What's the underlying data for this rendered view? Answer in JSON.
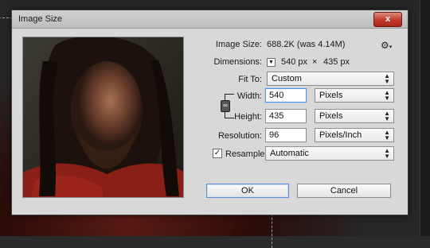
{
  "dialog": {
    "title": "Image Size",
    "close_label": "x"
  },
  "info": {
    "image_size_label": "Image Size:",
    "image_size_value": "688.2K (was 4.14M)",
    "dimensions_label": "Dimensions:",
    "dimensions_width": "540 px",
    "dimensions_sep": "×",
    "dimensions_height": "435 px"
  },
  "fit_to": {
    "label": "Fit To:",
    "value": "Custom"
  },
  "width": {
    "label": "Width:",
    "value": "540",
    "unit": "Pixels"
  },
  "height": {
    "label": "Height:",
    "value": "435",
    "unit": "Pixels"
  },
  "resolution": {
    "label": "Resolution:",
    "value": "96",
    "unit": "Pixels/Inch"
  },
  "resample": {
    "label": "Resample:",
    "checked": true,
    "value": "Automatic"
  },
  "buttons": {
    "ok": "OK",
    "cancel": "Cancel"
  },
  "icons": {
    "settings": "gear-icon",
    "link": "chain-link-icon",
    "close": "close-icon",
    "dropdown": "chevron-updown-icon"
  }
}
